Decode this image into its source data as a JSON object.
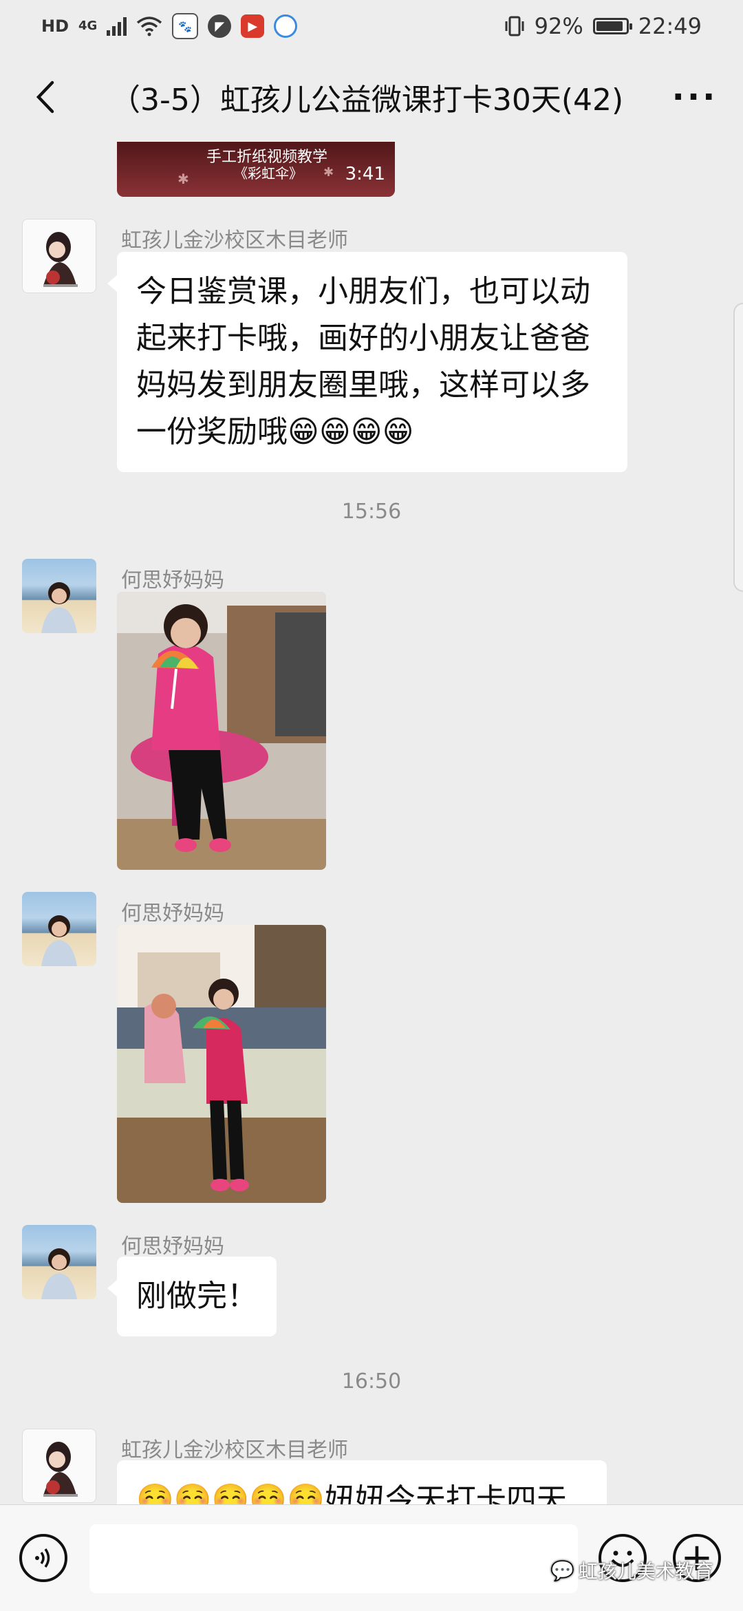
{
  "status_bar": {
    "network_hd": "HD",
    "network_4g": "4G",
    "battery_percent": "92%",
    "battery_level": 0.92,
    "time": "22:49"
  },
  "header": {
    "back_icon": "chevron-left-icon",
    "title": "（3-5）虹孩儿公益微课打卡30天(42)",
    "more_icon": "more-dots-icon"
  },
  "messages": {
    "video": {
      "caption_line1": "手工折纸视频教学",
      "caption_line2": "《彩虹伞》",
      "duration": "3:41"
    },
    "teacher_msg": {
      "sender": "虹孩儿金沙校区木目老师",
      "text": "今日鉴赏课，小朋友们，也可以动起来打卡哦，画好的小朋友让爸爸妈妈发到朋友圈里哦，这样可以多一份奖励哦😁😁😁😁"
    },
    "time1": "15:56",
    "mom_photo1": {
      "sender": "何思妤妈妈"
    },
    "mom_photo2": {
      "sender": "何思妤妈妈"
    },
    "mom_text": {
      "sender": "何思妤妈妈",
      "text": "刚做完！"
    },
    "time2": "16:50",
    "teacher_msg2": {
      "sender": "虹孩儿金沙校区木目老师",
      "text": "☺️☺️☺️☺️☺️妞妞今天打卡四天"
    }
  },
  "input_bar": {
    "voice_icon": "voice-icon",
    "emoji_icon": "emoji-icon",
    "plus_icon": "plus-icon",
    "watermark": "虹孩儿美术教育"
  },
  "colors": {
    "background": "#ededed",
    "bubble": "#ffffff",
    "meta_text": "#8a8a8a",
    "video_bg": "#7a2b2e"
  }
}
